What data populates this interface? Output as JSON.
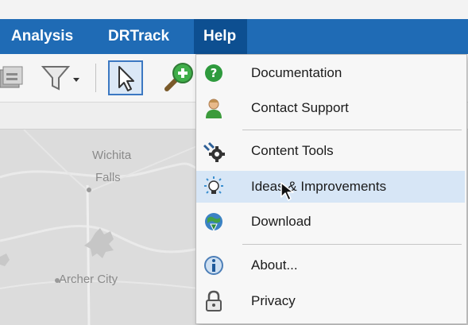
{
  "menubar": {
    "items": [
      {
        "label": "Analysis"
      },
      {
        "label": "DRTrack"
      },
      {
        "label": "Help"
      }
    ]
  },
  "map": {
    "labels": [
      "Wichita",
      "Falls",
      "Archer City"
    ]
  },
  "help_menu": {
    "items": [
      {
        "label": "Documentation",
        "icon": "question-icon"
      },
      {
        "label": "Contact Support",
        "icon": "support-person-icon"
      },
      {
        "label": "Content Tools",
        "icon": "tools-gear-icon"
      },
      {
        "label": "Ideas & Improvements",
        "icon": "lightbulb-icon"
      },
      {
        "label": "Download",
        "icon": "globe-download-icon"
      },
      {
        "label": "About...",
        "icon": "info-icon"
      },
      {
        "label": "Privacy",
        "icon": "padlock-icon"
      }
    ]
  },
  "colors": {
    "menubar_bg": "#1f6bb5",
    "menu_active_bg": "#0d4f91",
    "hover_item_bg": "#d7e6f6",
    "map_bg": "#dcdcdc"
  }
}
